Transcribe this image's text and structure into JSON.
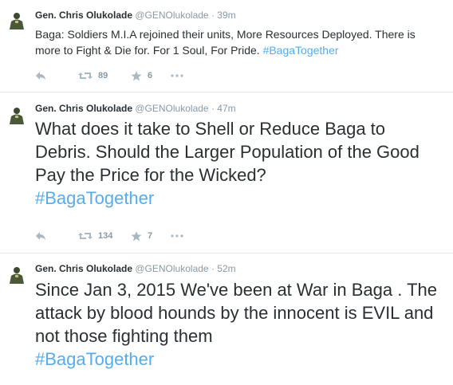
{
  "colors": {
    "accent": "#55acee",
    "muted": "#8899a6",
    "text": "#292f33",
    "divider": "#e1e8ed"
  },
  "tweets": [
    {
      "name": "Gen. Chris Olukolade",
      "handle": "@GENOlukolade",
      "separator": "·",
      "time": "39m",
      "text": "Baga: Soldiers M.I.A rejoined their units, More Resources Deployed. There is more to Fight & Die for. For 1 Soul, For Pride. ",
      "hashtag": "#BagaTogether",
      "retweets": "89",
      "favorites": "6",
      "icons": [
        "reply-icon",
        "retweet-icon",
        "favorite-icon",
        "more-icon"
      ]
    },
    {
      "name": "Gen. Chris Olukolade",
      "handle": "@GENOlukolade",
      "separator": "·",
      "time": "47m",
      "text": "What does it take to Shell or Reduce Baga to Debris. Should the Larger Population of the Good Pay the Price for the Wicked?",
      "hashtag": "#BagaTogether",
      "retweets": "134",
      "favorites": "7",
      "icons": [
        "reply-icon",
        "retweet-icon",
        "favorite-icon",
        "more-icon"
      ]
    },
    {
      "name": "Gen. Chris Olukolade",
      "handle": "@GENOlukolade",
      "separator": "·",
      "time": "52m",
      "text": "Since Jan 3, 2015 We've been at War in Baga . The attack by blood hounds by the innocent is EVIL and not those fighting them",
      "hashtag": "#BagaTogether"
    }
  ]
}
